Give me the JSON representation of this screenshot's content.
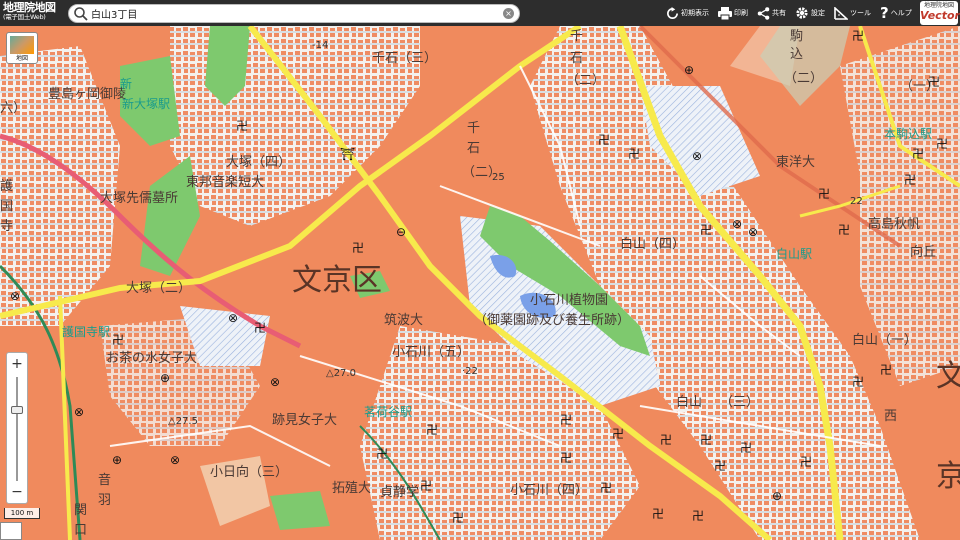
{
  "header": {
    "logo_title": "地理院地図",
    "logo_subtitle": "(電子国土Web)",
    "search_value": "白山3丁目",
    "tools": [
      {
        "name": "initial-view",
        "label": "初期表示",
        "icon": "refresh-icon"
      },
      {
        "name": "print",
        "label": "印刷",
        "icon": "printer-icon"
      },
      {
        "name": "share",
        "label": "共有",
        "icon": "share-icon"
      },
      {
        "name": "settings",
        "label": "設定",
        "icon": "gear-icon"
      },
      {
        "name": "tools",
        "label": "ツール",
        "icon": "ruler-icon"
      },
      {
        "name": "help",
        "label": "ヘルプ",
        "icon": "question-icon"
      }
    ],
    "vector_badge_top": "地理院地図",
    "vector_badge_bottom": "Vector"
  },
  "controls": {
    "layer_button_caption": "地図",
    "zoom_in": "+",
    "zoom_out": "−",
    "zoom_level_fraction": 0.3,
    "scale_label": "100 m"
  },
  "map": {
    "ward": "文京区",
    "labels": {
      "sengoku3": "千石（三）",
      "sengoku_a": "千",
      "sengoku_b": "石",
      "sengoku_c": "（二）",
      "sengoku_d": "千",
      "sengoku_e": "石",
      "sengoku_f": "（二）",
      "otsuka4": "大塚（四）",
      "toho": "東邦音楽短大",
      "otsuka2": "大塚（二）",
      "ochanomizu": "お茶の水女子大",
      "tsukuba": "筑波大",
      "koishikawa5": "小石川（五）",
      "koishikawa4": "小石川（四）",
      "botanical": "小石川植物園",
      "botanical2": "（御薬園跡及び養生所跡）",
      "hakusan4": "白山（四）",
      "hakusan_lbl": "白山",
      "hakusan_sub": "（三）",
      "hakusan_right": "白山（一）",
      "atomi": "跡見女子大",
      "kohinata": "小日向（三）",
      "toyo": "東洋大",
      "takushoku": "拓殖大",
      "hongo": "本駒込駅",
      "takashima": "高島秋帆",
      "hakusan_stn": "白山駅",
      "myogadani": "茗荷谷駅",
      "shin_otsuka": "新大塚駅",
      "gokokuji": "護国寺駅",
      "toshima": "豊島ヶ岡御陵",
      "otsuka_prefix": "大塚先儒墓所",
      "komagome_a": "駒",
      "komagome_b": "込",
      "komagome_c": "（二）",
      "komagome_d": "（一）",
      "bunkyo_right_a": "文",
      "bunkyo_right_b": "京",
      "mukougaoka": "向丘",
      "nishi": "西",
      "hakusan_right_c": "（一）",
      "otowa_a": "音",
      "otowa_b": "羽",
      "seki": "関",
      "sekiguchi": "口",
      "kaika": "貞静学",
      "elev1": "-14",
      "elev2": "25",
      "elev3": "△27.0",
      "elev4": "△27.5",
      "elev5": "·22",
      "elev6": "22",
      "edge_gokoku": "護",
      "edge_jiin": "国",
      "edge_temple": "寺",
      "edge_num": "六）",
      "new_a": "新"
    }
  }
}
